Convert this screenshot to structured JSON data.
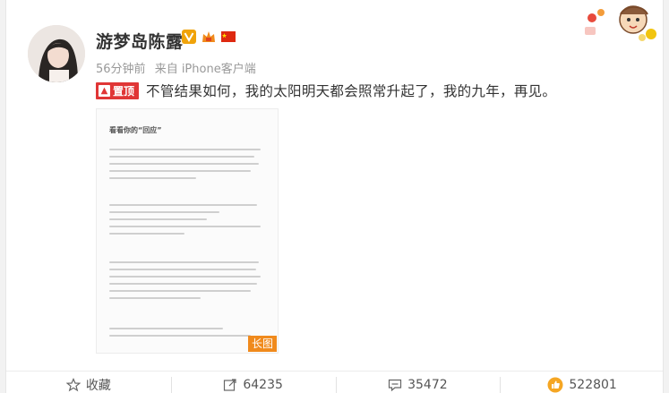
{
  "user": {
    "name": "游梦岛陈露",
    "time": "56分钟前",
    "source": "来自 iPhone客户端"
  },
  "post": {
    "pin_label": "置顶",
    "text": "不管结果如何，我的太阳明天都会照常升起了，我的九年，再见。",
    "image": {
      "title": "看看你的“回应”",
      "badge": "长图"
    }
  },
  "actions": {
    "favorite": "收藏",
    "repost": "64235",
    "comment": "35472",
    "like": "522801"
  },
  "colors": {
    "pin": "#e03636",
    "long_image_badge": "#f08a1c",
    "like_icon": "#f5a623"
  },
  "icons": [
    "star-icon",
    "share-icon",
    "comment-icon",
    "thumb-up-icon",
    "verified-icon",
    "member-icon",
    "flag-icon"
  ]
}
